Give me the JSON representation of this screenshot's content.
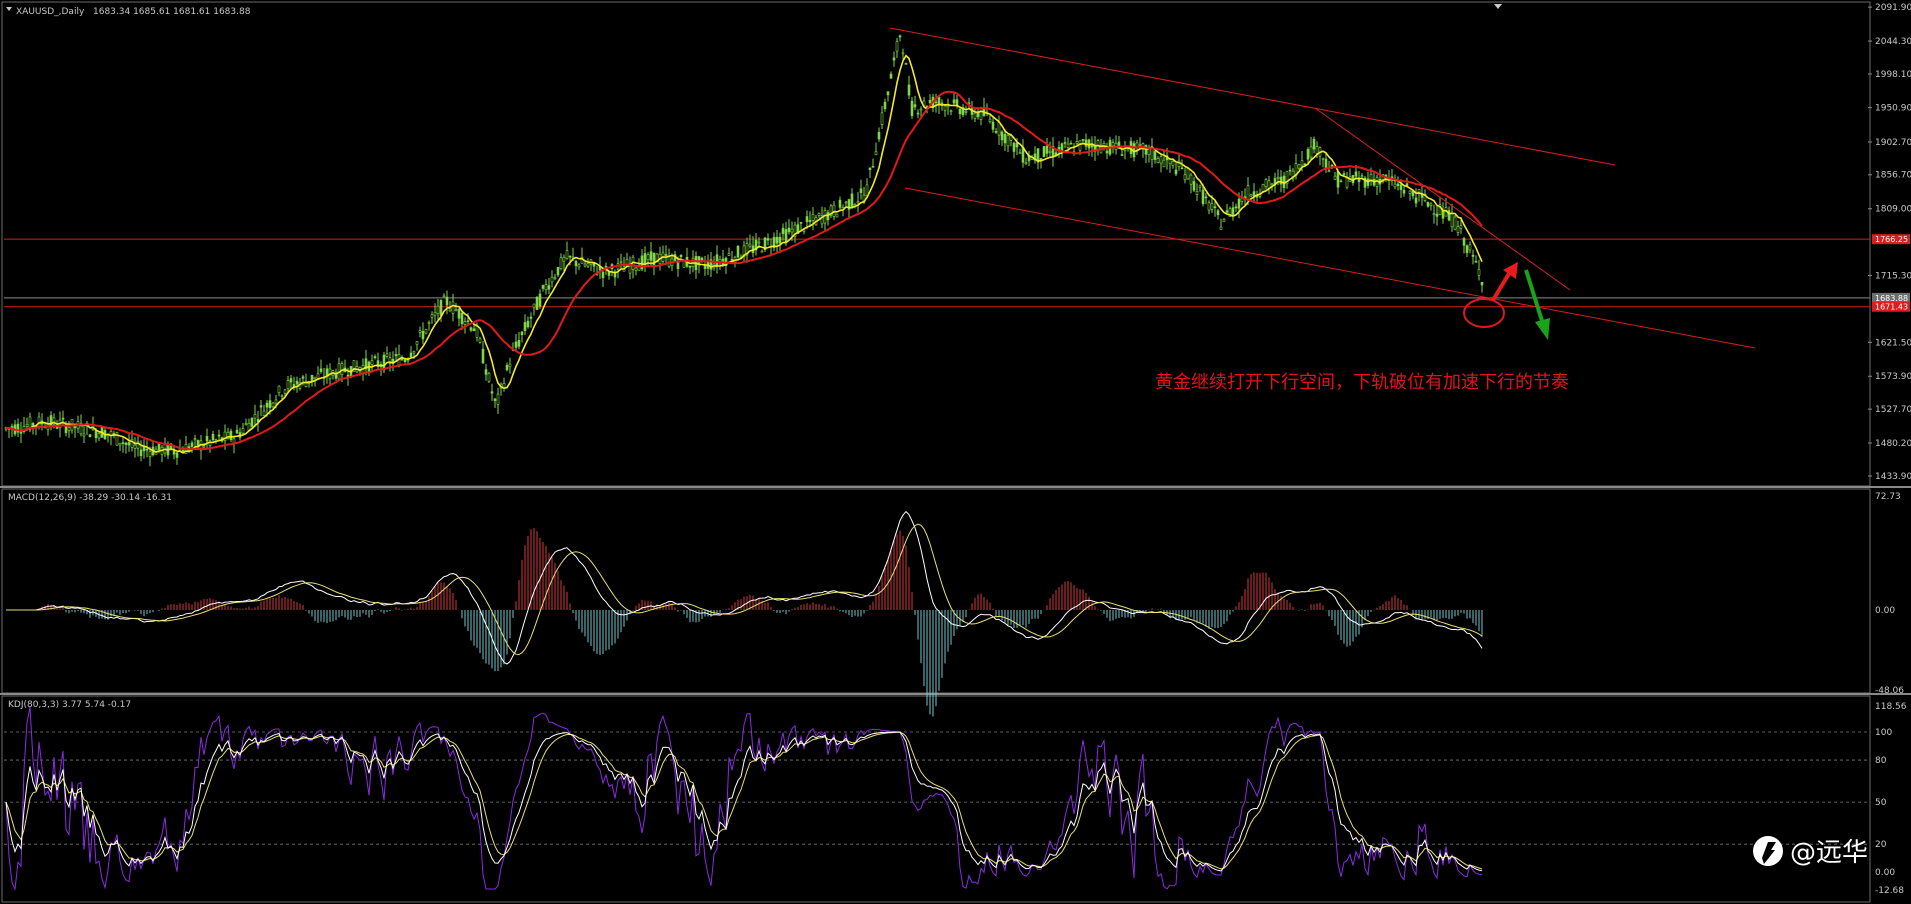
{
  "chart_data": [
    {
      "type": "candlestick",
      "panel": "price",
      "title": "XAUUSD_,Daily",
      "ohlc_last": "1683.34 1685.61 1681.61 1683.88",
      "y_ticks": [
        "2091.90",
        "2044.30",
        "1998.10",
        "1950.90",
        "1902.70",
        "1856.70",
        "1809.00",
        "1715.30",
        "1621.50",
        "1573.90",
        "1527.70",
        "1480.20",
        "1433.90"
      ],
      "ylim": [
        1433.9,
        2091.9
      ],
      "price_tags": [
        {
          "text": "1766.25",
          "value": 1766.25,
          "color": "#d81e1e"
        },
        {
          "text": "1683.88",
          "value": 1683.88,
          "color": "#6e6e6e"
        },
        {
          "text": "1671.43",
          "value": 1671.43,
          "color": "#d81e1e"
        }
      ],
      "horizontal_levels": [
        {
          "value": 1766.25,
          "color": "#d81e1e"
        },
        {
          "value": 1683.88,
          "color": "#8a8a8a"
        },
        {
          "value": 1671.43,
          "color": "#d81e1e"
        }
      ],
      "annotation": "黄金继续打开下行空间，下轨破位有加速下行的节奏",
      "colors": {
        "candles": "#7fd64a",
        "ma_fast": "#f2ea2a",
        "ma_slow": "#e01a1a",
        "trend": "#d81e1e",
        "up_arrow": "#e81c1c",
        "down_arrow": "#19a31a"
      }
    },
    {
      "type": "bar+line",
      "panel": "macd",
      "title": "MACD(12,26,9) -38.29 -30.14 -16.31",
      "y_ticks": [
        "72.73",
        "0.00",
        "-48.06"
      ],
      "ylim": [
        -48.06,
        72.73
      ],
      "colors": {
        "positive": "#d63a3a",
        "negative": "#6fc9d1",
        "line1": "#ffffff",
        "line2": "#e8e070"
      }
    },
    {
      "type": "line",
      "panel": "kdj",
      "title": "KDJ(80,3,3) 3.77 5.74 -0.17",
      "y_ticks": [
        "118.56",
        "100",
        "80",
        "50",
        "20",
        "0.00",
        "-12.68"
      ],
      "ylim": [
        -12.68,
        118.56
      ],
      "colors": {
        "k": "#ffffff",
        "d": "#e8e070",
        "j": "#8a2be2"
      }
    }
  ],
  "watermark": "@远华"
}
